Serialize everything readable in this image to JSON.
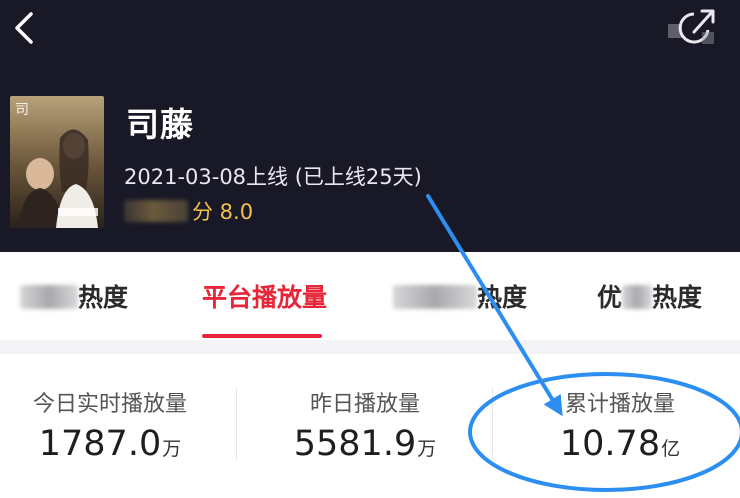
{
  "header": {
    "title": "司藤",
    "release_text": "2021-03-08上线 (已上线25天)",
    "rating_suffix": "分 8.0"
  },
  "tabs": [
    {
      "label_visible": "热度"
    },
    {
      "label": "平台播放量"
    },
    {
      "label_visible": "热度"
    },
    {
      "label_prefix": "优",
      "label_suffix": "热度"
    }
  ],
  "stats": [
    {
      "label": "今日实时播放量",
      "value": "1787.0",
      "unit": "万"
    },
    {
      "label": "昨日播放量",
      "value": "5581.9",
      "unit": "万"
    },
    {
      "label": "累计播放量",
      "value": "10.78",
      "unit": "亿"
    }
  ],
  "colors": {
    "header_bg": "#181826",
    "accent_red": "#e8263a",
    "rating_gold": "#f2c24a",
    "annotation_blue": "#2b8ef0"
  },
  "icons": {
    "back": "chevron-left-icon",
    "share": "share-icon"
  }
}
